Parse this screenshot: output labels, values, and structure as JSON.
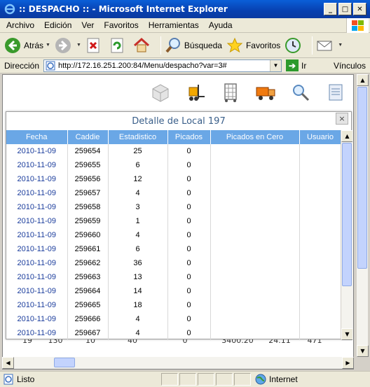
{
  "window": {
    "title": ":: DESPACHO :: - Microsoft Internet Explorer",
    "min_label": "_",
    "max_label": "□",
    "close_label": "✕"
  },
  "menu": [
    "Archivo",
    "Edición",
    "Ver",
    "Favoritos",
    "Herramientas",
    "Ayuda"
  ],
  "toolbar": {
    "back": "Atrás",
    "search": "Búsqueda",
    "favorites": "Favoritos"
  },
  "address": {
    "label": "Dirección",
    "url": "http://172.16.251.200:84/Menu/despacho?var=3#",
    "go": "Ir",
    "links": "Vínculos"
  },
  "background_row": {
    "c1": "19",
    "c2": "130",
    "c3": "10",
    "c4": "40",
    "c5": "0",
    "c6": "3400.20",
    "c7": "24.11",
    "c8": "471"
  },
  "modal": {
    "title": "Detalle de Local 197",
    "close": "×",
    "columns": [
      "Fecha",
      "Caddie",
      "Estadistico",
      "Picados",
      "Picados en Cero",
      "Usuario"
    ],
    "rows": [
      {
        "fecha": "2010-11-09",
        "caddie": "259654",
        "estadistico": "25",
        "picados": "0",
        "cero": "",
        "usuario": ""
      },
      {
        "fecha": "2010-11-09",
        "caddie": "259655",
        "estadistico": "6",
        "picados": "0",
        "cero": "",
        "usuario": ""
      },
      {
        "fecha": "2010-11-09",
        "caddie": "259656",
        "estadistico": "12",
        "picados": "0",
        "cero": "",
        "usuario": ""
      },
      {
        "fecha": "2010-11-09",
        "caddie": "259657",
        "estadistico": "4",
        "picados": "0",
        "cero": "",
        "usuario": ""
      },
      {
        "fecha": "2010-11-09",
        "caddie": "259658",
        "estadistico": "3",
        "picados": "0",
        "cero": "",
        "usuario": ""
      },
      {
        "fecha": "2010-11-09",
        "caddie": "259659",
        "estadistico": "1",
        "picados": "0",
        "cero": "",
        "usuario": ""
      },
      {
        "fecha": "2010-11-09",
        "caddie": "259660",
        "estadistico": "4",
        "picados": "0",
        "cero": "",
        "usuario": ""
      },
      {
        "fecha": "2010-11-09",
        "caddie": "259661",
        "estadistico": "6",
        "picados": "0",
        "cero": "",
        "usuario": ""
      },
      {
        "fecha": "2010-11-09",
        "caddie": "259662",
        "estadistico": "36",
        "picados": "0",
        "cero": "",
        "usuario": ""
      },
      {
        "fecha": "2010-11-09",
        "caddie": "259663",
        "estadistico": "13",
        "picados": "0",
        "cero": "",
        "usuario": ""
      },
      {
        "fecha": "2010-11-09",
        "caddie": "259664",
        "estadistico": "14",
        "picados": "0",
        "cero": "",
        "usuario": ""
      },
      {
        "fecha": "2010-11-09",
        "caddie": "259665",
        "estadistico": "18",
        "picados": "0",
        "cero": "",
        "usuario": ""
      },
      {
        "fecha": "2010-11-09",
        "caddie": "259666",
        "estadistico": "4",
        "picados": "0",
        "cero": "",
        "usuario": ""
      },
      {
        "fecha": "2010-11-09",
        "caddie": "259667",
        "estadistico": "4",
        "picados": "0",
        "cero": "",
        "usuario": ""
      }
    ]
  },
  "status": {
    "text": "Listo",
    "zone": "Internet"
  },
  "colors": {
    "header_bg": "#6aa7e6",
    "date_link": "#1a3c9c",
    "title_bar": "#0840b0",
    "modal_title": "#3a5f8a"
  }
}
